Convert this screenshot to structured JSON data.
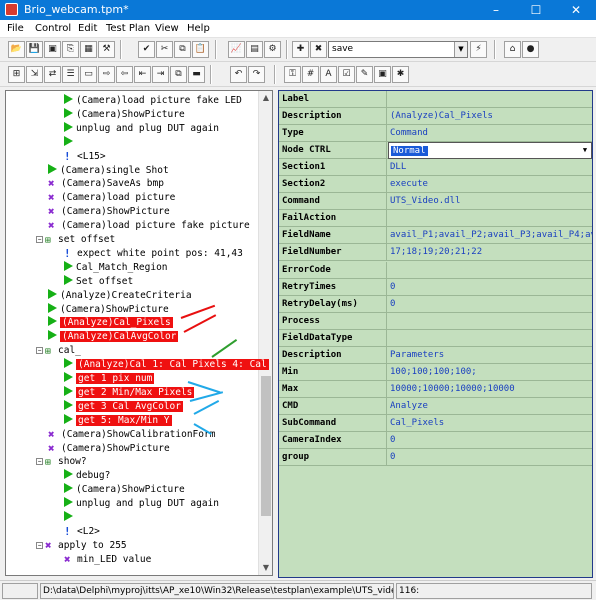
{
  "window": {
    "title": "Brio_webcam.tpm*",
    "min": "–",
    "max": "☐",
    "close": "✕"
  },
  "menu": [
    "File",
    "Control",
    "Edit",
    "Test Plan",
    "View",
    "Help"
  ],
  "toolbar": {
    "combo_value": "save"
  },
  "tree": [
    {
      "indent": 1,
      "icon": "play",
      "text": "(Camera)load picture fake LED"
    },
    {
      "indent": 1,
      "icon": "play",
      "text": "(Camera)ShowPicture"
    },
    {
      "indent": 1,
      "icon": "play",
      "text": "unplug and plug DUT again"
    },
    {
      "indent": 1,
      "icon": "play",
      "text": ""
    },
    {
      "indent": 1,
      "icon": "bulb",
      "text": "<L15>"
    },
    {
      "indent": 0,
      "icon": "play",
      "text": "(Camera)single Shot"
    },
    {
      "indent": 0,
      "icon": "x",
      "text": "(Camera)SaveAs bmp"
    },
    {
      "indent": 0,
      "icon": "x",
      "text": "(Camera)load picture"
    },
    {
      "indent": 0,
      "icon": "x",
      "text": "(Camera)ShowPicture"
    },
    {
      "indent": 0,
      "icon": "x",
      "text": "(Camera)load picture fake picture"
    },
    {
      "indent": 0,
      "icon": "expand",
      "text": "set offset"
    },
    {
      "indent": 1,
      "icon": "bulb",
      "text": "expect  white point pos: 41,43"
    },
    {
      "indent": 1,
      "icon": "play",
      "text": "Cal_Match_Region"
    },
    {
      "indent": 1,
      "icon": "play",
      "text": "Set offset"
    },
    {
      "indent": 0,
      "icon": "play",
      "text": "(Analyze)CreateCriteria"
    },
    {
      "indent": 0,
      "icon": "play",
      "text": "(Camera)ShowPicture"
    },
    {
      "indent": 0,
      "icon": "play",
      "text": "(Analyze)Cal_Pixels",
      "hl": true
    },
    {
      "indent": 0,
      "icon": "play",
      "text": "(Analyze)CalAvgColor",
      "hl": true
    },
    {
      "indent": 0,
      "icon": "expand",
      "text": "cal_"
    },
    {
      "indent": 1,
      "icon": "play",
      "text": "(Analyze)Cal 1: Cal Pixels 4: Cal",
      "hl": true
    },
    {
      "indent": 1,
      "icon": "play",
      "text": "get 1 pix num",
      "hl": true
    },
    {
      "indent": 1,
      "icon": "play",
      "text": "get 2 Min/Max Pixels",
      "hl": true
    },
    {
      "indent": 1,
      "icon": "play",
      "text": "get 3 Cal AvgColor",
      "hl": true
    },
    {
      "indent": 1,
      "icon": "play",
      "text": "get 5: Max/Min Y",
      "hl": true
    },
    {
      "indent": 0,
      "icon": "x",
      "text": "(Camera)ShowCalibrationForm"
    },
    {
      "indent": 0,
      "icon": "x",
      "text": "(Camera)ShowPicture"
    },
    {
      "indent": 0,
      "icon": "expand",
      "text": "show?"
    },
    {
      "indent": 1,
      "icon": "play",
      "text": "debug?"
    },
    {
      "indent": 1,
      "icon": "play",
      "text": "(Camera)ShowPicture"
    },
    {
      "indent": 1,
      "icon": "play",
      "text": "unplug and plug DUT again"
    },
    {
      "indent": 1,
      "icon": "play",
      "text": ""
    },
    {
      "indent": 1,
      "icon": "bulb",
      "text": "<L2>"
    },
    {
      "indent": 0,
      "icon": "expandx",
      "text": "apply to 255"
    },
    {
      "indent": 1,
      "icon": "x",
      "text": "min_LED value"
    }
  ],
  "props": [
    {
      "key": "Label",
      "value": ""
    },
    {
      "key": "Description",
      "value": "(Analyze)Cal_Pixels"
    },
    {
      "key": "Type",
      "value": "Command"
    },
    {
      "key": "Node CTRL",
      "value": "Normal",
      "selected": true
    },
    {
      "key": "Section1",
      "value": "DLL"
    },
    {
      "key": "Section2",
      "value": "execute"
    },
    {
      "key": "Command",
      "value": "UTS_Video.dll"
    },
    {
      "key": "FailAction",
      "value": ""
    },
    {
      "key": "FieldName",
      "value": "avail_P1;avail_P2;avail_P3;avail_P4;av"
    },
    {
      "key": "FieldNumber",
      "value": "17;18;19;20;21;22"
    },
    {
      "key": "ErrorCode",
      "value": ""
    },
    {
      "key": "RetryTimes",
      "value": "0"
    },
    {
      "key": "RetryDelay(ms)",
      "value": "0"
    },
    {
      "key": "Process",
      "value": ""
    },
    {
      "key": "FieldDataType",
      "value": ""
    },
    {
      "key": "Description",
      "value": "Parameters"
    },
    {
      "key": "Min",
      "value": "100;100;100;100;"
    },
    {
      "key": "Max",
      "value": "10000;10000;10000;10000"
    },
    {
      "key": "CMD",
      "value": "Analyze"
    },
    {
      "key": "SubCommand",
      "value": "Cal_Pixels"
    },
    {
      "key": "CameraIndex",
      "value": "0"
    },
    {
      "key": "group",
      "value": "0"
    }
  ],
  "status": {
    "left": "",
    "path": "D:\\data\\Delphi\\myproj\\itts\\AP_xe10\\Win32\\Release\\testplan\\example\\UTS_vide",
    "count": "116:"
  }
}
